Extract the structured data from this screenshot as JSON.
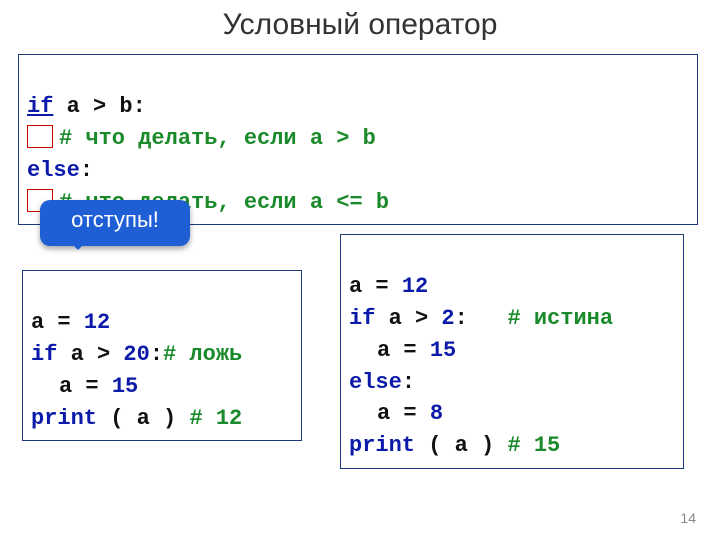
{
  "title": "Условный оператор",
  "page_number": "14",
  "callout": "отступы!",
  "top_block": {
    "l1_if": "if",
    "l1_rest": " a > b:",
    "l2_comment": "# что делать, если a > b",
    "l3_else": "else",
    "l3_colon": ":",
    "l4_comment": "# что делать, если a <= b"
  },
  "left_block": {
    "l1_a": "a = ",
    "l1_aval": "12",
    "l2_if": "if",
    "l2_cond": " a > ",
    "l2_num": "20",
    "l2_colon": ":",
    "l2_com": "# ложь",
    "l3_body": "a = ",
    "l3_num": "15",
    "l4_print": "print",
    "l4_rest": " ( a ) ",
    "l4_com": "# 12"
  },
  "right_block": {
    "l1_a": "a = ",
    "l1_aval": "12",
    "l2_if": "if",
    "l2_cond": " a > ",
    "l2_num": "2",
    "l2_colon": ":   ",
    "l2_com": "# истина",
    "l3_body": "a = ",
    "l3_num": "15",
    "l4_else": "else",
    "l4_colon": ":",
    "l5_body": "a = ",
    "l5_num": "8",
    "l6_print": "print",
    "l6_rest": " ( a ) ",
    "l6_com": "# 15"
  }
}
